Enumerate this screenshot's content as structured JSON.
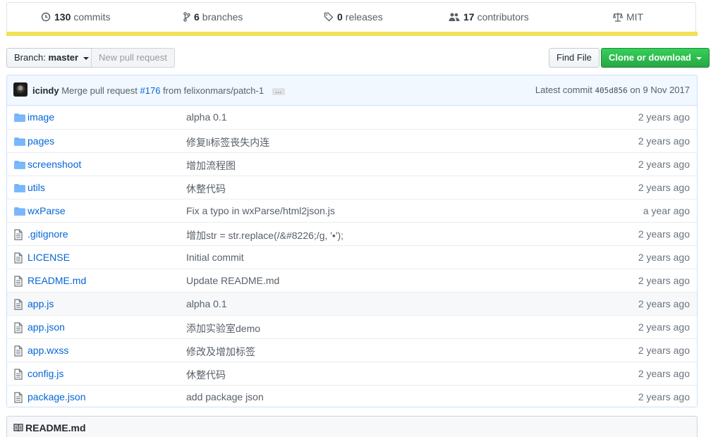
{
  "summary": {
    "commits": {
      "count": "130",
      "label": "commits"
    },
    "branches": {
      "count": "6",
      "label": "branches"
    },
    "releases": {
      "count": "0",
      "label": "releases"
    },
    "contributors": {
      "count": "17",
      "label": "contributors"
    },
    "license": "MIT",
    "language_color": "#f1e05a"
  },
  "toolbar": {
    "branch_label": "Branch:",
    "branch_name": "master",
    "new_pr": "New pull request",
    "find_file": "Find File",
    "clone": "Clone or download"
  },
  "commit_tease": {
    "author": "icindy",
    "message_prefix": "Merge pull request",
    "pr_link": "#176",
    "message_suffix": "from felixonmars/patch-1",
    "ellipsis": "…",
    "latest_label": "Latest commit",
    "sha": "405d856",
    "date": "on 9 Nov 2017"
  },
  "files": [
    {
      "type": "dir",
      "name": "image",
      "message": "alpha 0.1",
      "age": "2 years ago"
    },
    {
      "type": "dir",
      "name": "pages",
      "message": "修复li标签丧失内连",
      "age": "2 years ago"
    },
    {
      "type": "dir",
      "name": "screenshoot",
      "message": "增加流程图",
      "age": "2 years ago"
    },
    {
      "type": "dir",
      "name": "utils",
      "message": "休整代码",
      "age": "2 years ago"
    },
    {
      "type": "dir",
      "name": "wxParse",
      "message": "Fix a typo in wxParse/html2json.js",
      "age": "a year ago"
    },
    {
      "type": "file",
      "name": ".gitignore",
      "message": "增加str = str.replace(/&#8226;/g, '•');",
      "age": "2 years ago"
    },
    {
      "type": "file",
      "name": "LICENSE",
      "message": "Initial commit",
      "age": "2 years ago"
    },
    {
      "type": "file",
      "name": "README.md",
      "message": "Update README.md",
      "age": "2 years ago"
    },
    {
      "type": "file",
      "name": "app.js",
      "message": "alpha 0.1",
      "age": "2 years ago"
    },
    {
      "type": "file",
      "name": "app.json",
      "message": "添加实验室demo",
      "age": "2 years ago"
    },
    {
      "type": "file",
      "name": "app.wxss",
      "message": "修改及增加标签",
      "age": "2 years ago"
    },
    {
      "type": "file",
      "name": "config.js",
      "message": "休整代码",
      "age": "2 years ago"
    },
    {
      "type": "file",
      "name": "package.json",
      "message": "add package json",
      "age": "2 years ago"
    }
  ],
  "readme": {
    "title": "README.md"
  }
}
